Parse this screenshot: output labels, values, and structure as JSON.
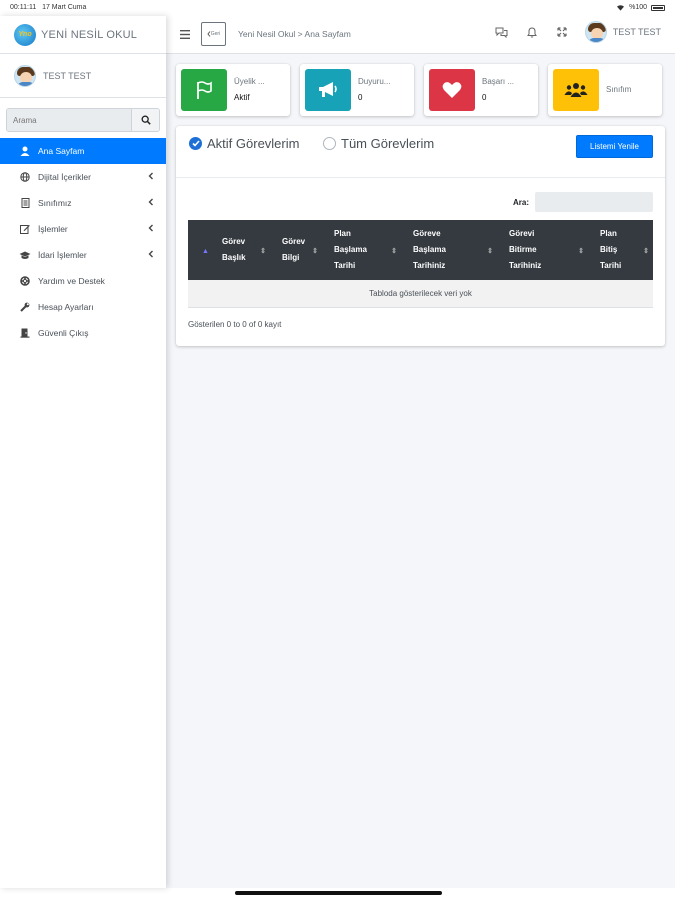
{
  "status": {
    "time": "00:11:11",
    "date": "17 Mart Cuma",
    "battery": "%100"
  },
  "brand": {
    "title": "YENİ NESİL OKUL",
    "logo_text": "Yno"
  },
  "user": {
    "name": "TEST TEST"
  },
  "search": {
    "placeholder": "Arama"
  },
  "nav": {
    "items": [
      {
        "label": "Ana Sayfam",
        "icon": "user-icon",
        "active": true
      },
      {
        "label": "Dijital İçerikler",
        "icon": "globe-icon",
        "has_children": true
      },
      {
        "label": "Sınıfımız",
        "icon": "book-icon",
        "has_children": true
      },
      {
        "label": "İşlemler",
        "icon": "edit-icon",
        "has_children": true
      },
      {
        "label": "İdari İşlemler",
        "icon": "graduation-cap-icon",
        "has_children": true
      },
      {
        "label": "Yardım ve Destek",
        "icon": "lifering-icon"
      },
      {
        "label": "Hesap Ayarları",
        "icon": "wrench-icon"
      },
      {
        "label": "Güvenli Çıkış",
        "icon": "logout-icon"
      }
    ]
  },
  "topbar": {
    "back_label": "Geri",
    "breadcrumb": "Yeni Nesil Okul > Ana Sayfam",
    "user_name": "TEST TEST"
  },
  "info_boxes": [
    {
      "label": "Üyelik ...",
      "value": "Aktif",
      "color": "#28a745",
      "icon": "flag-icon"
    },
    {
      "label": "Duyuru...",
      "value": "0",
      "color": "#17a2b8",
      "icon": "megaphone-icon"
    },
    {
      "label": "Başarı ...",
      "value": "0",
      "color": "#dc3545",
      "icon": "heart-icon"
    },
    {
      "label": "Sınıfım",
      "value": "",
      "color": "#ffc107",
      "icon": "users-icon"
    }
  ],
  "tasks": {
    "radio_active": "Aktif Görevlerim",
    "radio_all": "Tüm Görevlerim",
    "refresh_label": "Listemi Yenile",
    "search_label": "Ara:",
    "columns": [
      [
        "Görev",
        "Başlık"
      ],
      [
        "Görev",
        "Bilgi"
      ],
      [
        "Plan",
        "Başlama",
        "Tarihi"
      ],
      [
        "Göreve",
        "Başlama",
        "Tarihiniz"
      ],
      [
        "Görevi",
        "Bitirme",
        "Tarihiniz"
      ],
      [
        "Plan",
        "Bitiş",
        "Tarihi"
      ]
    ],
    "empty_text": "Tabloda gösterilecek veri yok",
    "info": "Gösterilen 0 to 0 of 0 kayıt"
  },
  "accent_color": "#007bff"
}
